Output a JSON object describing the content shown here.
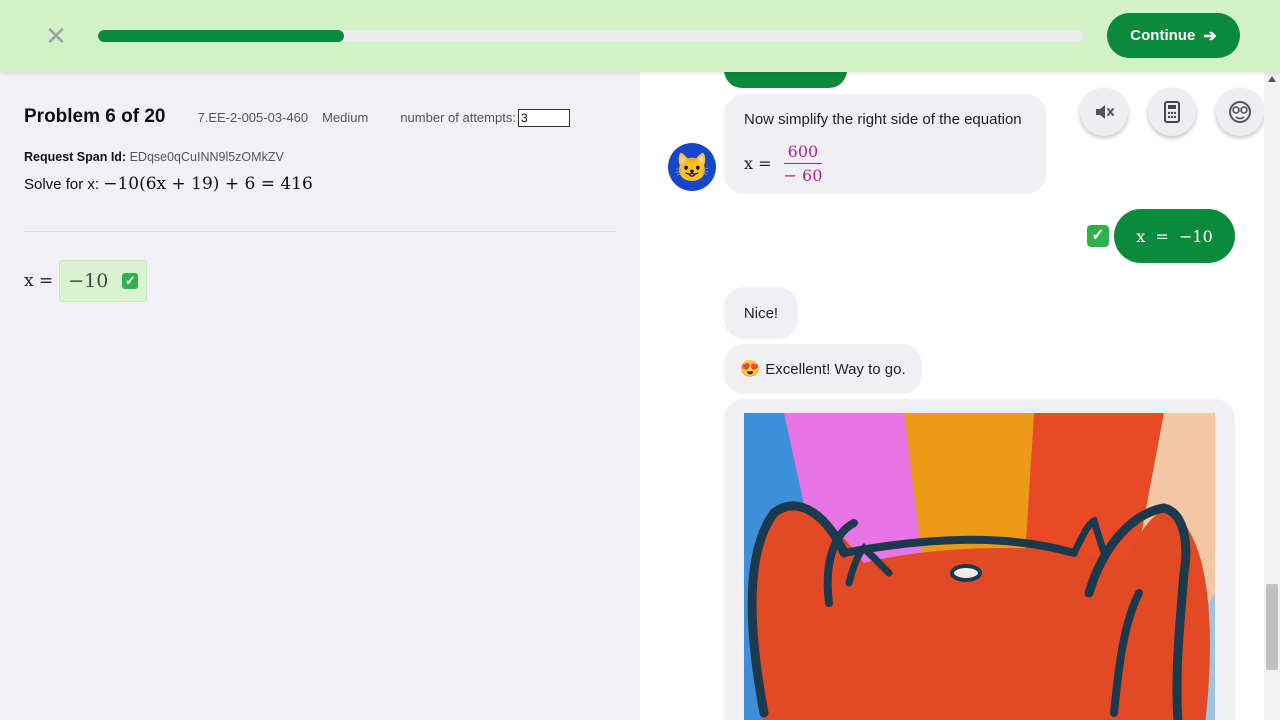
{
  "header": {
    "close_icon": "close-icon",
    "progress": 0.25,
    "continue_label": "Continue",
    "continue_icon": "arrow-right-icon"
  },
  "problem": {
    "title": "Problem 6 of 20",
    "code": "7.EE-2-005-03-460",
    "difficulty": "Medium",
    "attempts_label": "number of attempts:",
    "attempts_value": "3",
    "span_label": "Request Span Id:",
    "span_id": "EDqse0qCuINN9l5zOMkZV",
    "solve_prefix": "Solve for x:",
    "equation": "−10(6x + 19) + 6 = 416",
    "answer_lhs": "x =",
    "answer_value": "−10"
  },
  "chat": {
    "tutor_message_1": "Now simplify the right side of the equation",
    "eq_lhs": "x =",
    "eq_num": "600",
    "eq_den": "− 60",
    "user_answer": "x  =  −10",
    "nice": "Nice!",
    "excellent": "Excellent! Way to go.",
    "avatar_icon": "cat-face-icon"
  },
  "tools": {
    "mute_icon": "speaker-muted-icon",
    "calculator_icon": "calculator-icon",
    "help_icon": "face-icon"
  },
  "colors": {
    "brand_green": "#0c8a3c",
    "header_bg": "#d1f2c4",
    "fraction_magenta": "#b2228f",
    "avatar_blue": "#1747c9"
  }
}
